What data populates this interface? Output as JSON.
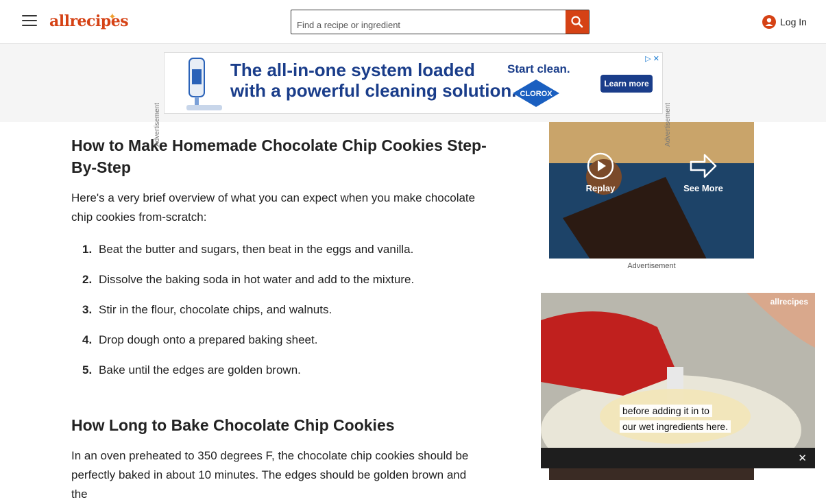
{
  "header": {
    "logo_text": "allrecipes",
    "search_placeholder": "Find a recipe or ingredient",
    "login_label": "Log In"
  },
  "ads": {
    "side_label": "Advertisement",
    "banner_headline_1": "The all-in-one system loaded",
    "banner_headline_2": "with a powerful cleaning solution.",
    "banner_start": "Start clean.",
    "banner_brand": "CLOROX",
    "banner_cta": "Learn more",
    "sidebar_replay": "Replay",
    "sidebar_see_more": "See More",
    "sidebar_label": "Advertisement"
  },
  "article": {
    "heading_1": "How to Make Homemade Chocolate Chip Cookies Step-By-Step",
    "intro": "Here's a very brief overview of what you can expect when you make chocolate chip cookies from-scratch:",
    "steps": [
      {
        "num": "1.",
        "text": "Beat the butter and sugars, then beat in the eggs and vanilla."
      },
      {
        "num": "2.",
        "text": "Dissolve the baking soda in hot water and add to the mixture."
      },
      {
        "num": "3.",
        "text": "Stir in the flour, chocolate chips, and walnuts."
      },
      {
        "num": "4.",
        "text": "Drop dough onto a prepared baking sheet."
      },
      {
        "num": "5.",
        "text": "Bake until the edges are golden brown."
      }
    ],
    "heading_2": "How Long to Bake Chocolate Chip Cookies",
    "bake_text": "In an oven preheated to 350 degrees F, the chocolate chip cookies should be perfectly baked in about 10 minutes. The edges should be golden brown and the"
  },
  "video": {
    "watermark": "allrecipes",
    "caption_1": "before adding it in to",
    "caption_2": "our wet ingredients here.",
    "close_label": "✕"
  }
}
